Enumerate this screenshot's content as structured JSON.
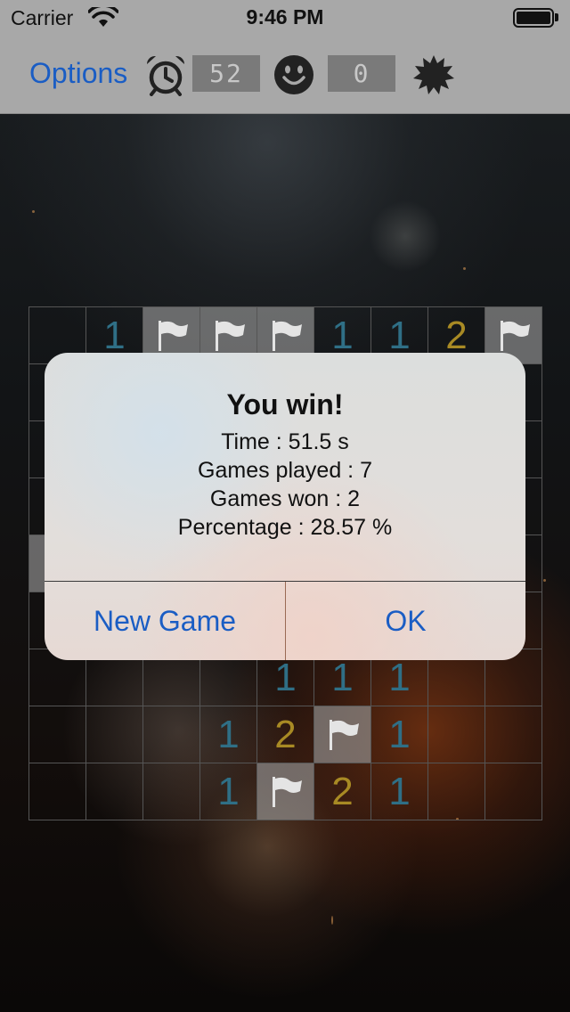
{
  "status_bar": {
    "carrier": "Carrier",
    "time": "9:46 PM",
    "icons": [
      "wifi-icon",
      "battery-icon"
    ]
  },
  "toolbar": {
    "options_label": "Options",
    "timer_value": "52",
    "mine_counter_value": "0",
    "icons": [
      "alarm-clock-icon",
      "smiley-icon",
      "mine-icon"
    ]
  },
  "board": {
    "rows": 9,
    "cols": 9,
    "visible_cells": [
      {
        "row": 0,
        "col": 1,
        "content": "1"
      },
      {
        "row": 0,
        "col": 2,
        "content": "flag"
      },
      {
        "row": 0,
        "col": 3,
        "content": "flag"
      },
      {
        "row": 0,
        "col": 4,
        "content": "flag"
      },
      {
        "row": 0,
        "col": 5,
        "content": "1"
      },
      {
        "row": 0,
        "col": 6,
        "content": "1"
      },
      {
        "row": 0,
        "col": 7,
        "content": "2"
      },
      {
        "row": 0,
        "col": 8,
        "content": "flag"
      },
      {
        "row": 4,
        "col": 0,
        "content": "covered"
      },
      {
        "row": 6,
        "col": 4,
        "content": "1"
      },
      {
        "row": 6,
        "col": 5,
        "content": "1"
      },
      {
        "row": 6,
        "col": 6,
        "content": "1"
      },
      {
        "row": 7,
        "col": 3,
        "content": "1"
      },
      {
        "row": 7,
        "col": 4,
        "content": "2"
      },
      {
        "row": 7,
        "col": 5,
        "content": "flag"
      },
      {
        "row": 7,
        "col": 6,
        "content": "1"
      },
      {
        "row": 8,
        "col": 3,
        "content": "1"
      },
      {
        "row": 8,
        "col": 4,
        "content": "flag"
      },
      {
        "row": 8,
        "col": 5,
        "content": "2"
      },
      {
        "row": 8,
        "col": 6,
        "content": "1"
      }
    ]
  },
  "alert": {
    "title": "You win!",
    "lines": [
      "Time : 51.5 s",
      "Games played : 7",
      "Games won : 2",
      "Percentage : 28.57 %"
    ],
    "new_game_label": "New Game",
    "ok_label": "OK"
  },
  "colors": {
    "accent_blue": "#1a5dc4",
    "number_one": "#2f6f86",
    "number_two": "#a88a24",
    "bar_gray": "#a8a8a8"
  }
}
